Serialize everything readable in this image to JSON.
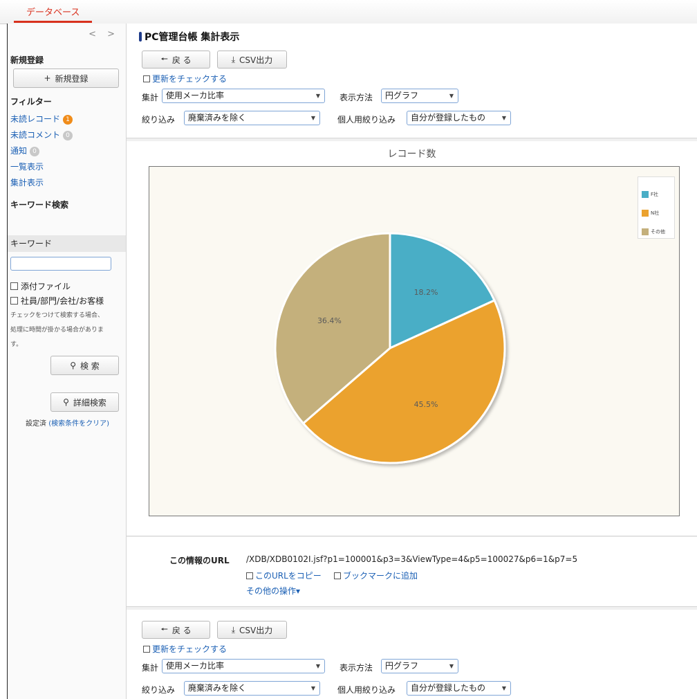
{
  "topbar": {
    "tab_label": "データベース"
  },
  "sidebar": {
    "nav_arrows": "< >",
    "new_heading": "新規登録",
    "new_button": "新規登録",
    "filter_heading": "フィルター",
    "unread_records": "未読レコード",
    "unread_records_count": "1",
    "unread_comments": "未読コメント",
    "unread_comments_count": "0",
    "notifications": "通知",
    "notifications_count": "0",
    "list_view": "一覧表示",
    "summary_view": "集計表示",
    "keyword_heading": "キーワード検索",
    "keyword_label": "キーワード",
    "keyword_value": "",
    "attach_checkbox": "添付ファイル",
    "people_checkbox": "社員/部門/会社/お客様",
    "note_line1": "チェックをつけて検索する場合、",
    "note_line2": "処理に時間が掛かる場合がありま",
    "note_line3": "す。",
    "search_button": "検 索",
    "detail_search_button": "詳細検索",
    "setting_text": "設定済",
    "clear_link": "(検索条件をクリア)"
  },
  "main": {
    "title": "PC管理台帳 集計表示",
    "back_button": "戻 る",
    "csv_button": "CSV出力",
    "check_updates": "更新をチェックする",
    "aggregate_label": "集計",
    "aggregate_value": "使用メーカ比率",
    "display_label": "表示方法",
    "display_value": "円グラフ",
    "filter_label": "絞り込み",
    "filter_value": "廃棄済みを除く",
    "personal_filter_label": "個人用絞り込み",
    "personal_filter_value": "自分が登録したもの"
  },
  "chart_data": {
    "type": "pie",
    "title": "レコード数",
    "categories": [
      "F社",
      "N社",
      "その他"
    ],
    "values": [
      18.2,
      45.5,
      36.4
    ],
    "labels": [
      "18.2%",
      "45.5%",
      "36.4%"
    ],
    "colors": [
      "#4aaec6",
      "#eba22f",
      "#c4b07c"
    ],
    "legend_position": "top-right"
  },
  "url_section": {
    "label": "この情報のURL",
    "value": "/XDB/XDB0102I.jsf?p1=100001&p3=3&ViewType=4&p5=100027&p6=1&p7=5",
    "copy_link": "このURLをコピー",
    "bookmark_link": "ブックマークに追加",
    "other_ops": "その他の操作▾"
  }
}
